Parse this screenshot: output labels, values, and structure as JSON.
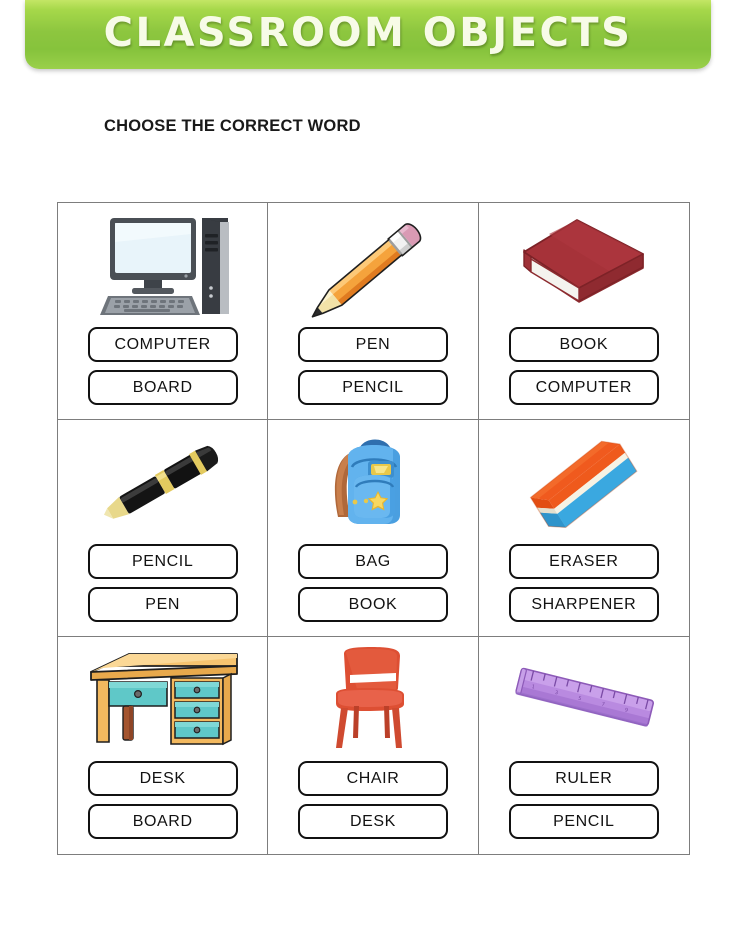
{
  "header": {
    "title": "CLASSROOM OBJECTS",
    "banner_color": "#8dc63f",
    "title_color": "#f7fbe7"
  },
  "instruction": "CHOOSE THE CORRECT WORD",
  "grid": {
    "columns": 3,
    "rows": 3,
    "border_color": "#7d7d7d",
    "option_border_color": "#111111",
    "cells": [
      {
        "icon": "computer-icon",
        "answer": "COMPUTER",
        "options": [
          "COMPUTER",
          "BOARD"
        ]
      },
      {
        "icon": "pencil-icon",
        "answer": "PENCIL",
        "options": [
          "PEN",
          "PENCIL"
        ]
      },
      {
        "icon": "book-icon",
        "answer": "BOOK",
        "options": [
          "BOOK",
          "COMPUTER"
        ]
      },
      {
        "icon": "pen-icon",
        "answer": "PEN",
        "options": [
          "PENCIL",
          "PEN"
        ]
      },
      {
        "icon": "backpack-icon",
        "answer": "BAG",
        "options": [
          "BAG",
          "BOOK"
        ]
      },
      {
        "icon": "eraser-icon",
        "answer": "ERASER",
        "options": [
          "ERASER",
          "SHARPENER"
        ]
      },
      {
        "icon": "desk-icon",
        "answer": "DESK",
        "options": [
          "DESK",
          "BOARD"
        ]
      },
      {
        "icon": "chair-icon",
        "answer": "CHAIR",
        "options": [
          "CHAIR",
          "DESK"
        ]
      },
      {
        "icon": "ruler-icon",
        "answer": "RULER",
        "options": [
          "RULER",
          "PENCIL"
        ]
      }
    ]
  }
}
